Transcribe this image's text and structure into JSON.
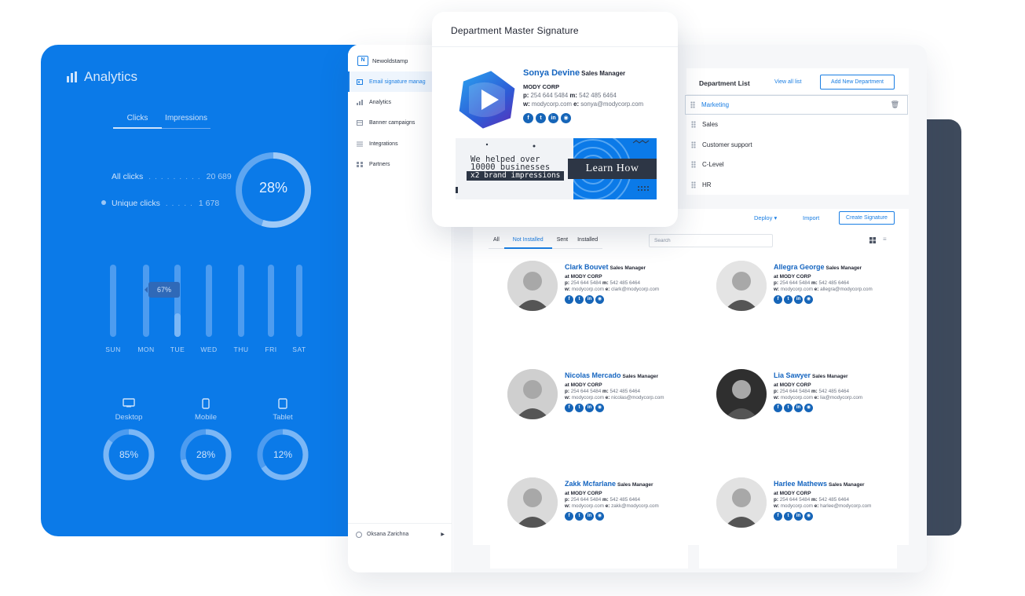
{
  "analytics": {
    "title": "Analytics",
    "tabs": [
      "Clicks",
      "Impressions"
    ],
    "all_clicks_label": "All clicks",
    "all_clicks_value": "20 689",
    "unique_clicks_label": "Unique clicks",
    "unique_clicks_value": "1 678",
    "ring_percent": "28%",
    "ring_fraction": 0.28,
    "weekly": {
      "days": [
        "SUN",
        "MON",
        "TUE",
        "WED",
        "THU",
        "FRI",
        "SAT"
      ],
      "tooltip": "67%"
    },
    "devices": [
      {
        "label": "Desktop",
        "value": "85%"
      },
      {
        "label": "Mobile",
        "value": "28%"
      },
      {
        "label": "Tablet",
        "value": "12%"
      }
    ]
  },
  "sidebar": {
    "brand": "Newoldstamp",
    "items": [
      {
        "label": "Email signature manag",
        "icon": "signature-icon",
        "active": true
      },
      {
        "label": "Analytics",
        "icon": "analytics-icon"
      },
      {
        "label": "Banner campaigns",
        "icon": "banner-icon"
      },
      {
        "label": "Integrations",
        "icon": "integrations-icon"
      },
      {
        "label": "Partners",
        "icon": "partners-icon"
      }
    ],
    "user": "Oksana Zarichna"
  },
  "departments": {
    "title": "Department List",
    "view_all": "View all list",
    "add_button": "Add New Department",
    "items": [
      "Marketing",
      "Sales",
      "Customer support",
      "C-Level",
      "HR"
    ],
    "selected": "Marketing"
  },
  "toolbar": {
    "deploy": "Deploy",
    "import": "Import",
    "create": "Create Signature",
    "filters": [
      "All",
      "Not Installed",
      "Sent",
      "Installed"
    ],
    "active_filter": "Not Installed",
    "search_placeholder": "Search"
  },
  "signatures": [
    {
      "name": "Clark Bouvet",
      "role": "Sales Manager",
      "company": "at MODY CORP",
      "p": "254 644 5484",
      "m": "542 485 6464",
      "w": "modycorp.com",
      "e": "clark@modycorp.com"
    },
    {
      "name": "Allegra George",
      "role": "Sales Manager",
      "company": "at MODY CORP",
      "p": "254 644 5484",
      "m": "542 485 6464",
      "w": "modycorp.com",
      "e": "allegra@modycorp.com"
    },
    {
      "name": "Nicolas Mercado",
      "role": "Sales Manager",
      "company": "at MODY CORP",
      "p": "254 644 5484",
      "m": "542 485 6464",
      "w": "modycorp.com",
      "e": "nicolas@modycorp.com"
    },
    {
      "name": "Lia Sawyer",
      "role": "Sales Manager",
      "company": "at MODY CORP",
      "p": "254 644 5484",
      "m": "542 485 6464",
      "w": "modycorp.com",
      "e": "lia@modycorp.com"
    },
    {
      "name": "Zakk Mcfarlane",
      "role": "Sales Manager",
      "company": "at MODY CORP",
      "p": "254 644 5484",
      "m": "542 485 6464",
      "w": "modycorp.com",
      "e": "zakk@modycorp.com"
    },
    {
      "name": "Harlee Mathews",
      "role": "Sales Manager",
      "company": "at MODY CORP",
      "p": "254 644 5484",
      "m": "542 485 6464",
      "w": "modycorp.com",
      "e": "harlee@modycorp.com"
    }
  ],
  "master": {
    "title": "Department Master Signature",
    "name": "Sonya Devine",
    "role": "Sales Manager",
    "company": "MODY CORP",
    "p": "254 644 5484",
    "m": "542 485 6464",
    "w": "modycorp.com",
    "e": "sonya@modycorp.com",
    "banner_line1": "We helped over",
    "banner_line2": "10000 businesses",
    "banner_line3": "x2 brand impressions",
    "banner_cta": "Learn How"
  },
  "labels": {
    "p": "p:",
    "m": "m:",
    "w": "w:",
    "e": "e:"
  },
  "social_icons": [
    "facebook-icon",
    "twitter-icon",
    "linkedin-icon",
    "instagram-icon"
  ],
  "colors": {
    "accent": "#1a7ee3",
    "analytics_bg": "#0b7ae8",
    "name_blue": "#1565c0",
    "dark_slab": "#3e4a5c"
  }
}
